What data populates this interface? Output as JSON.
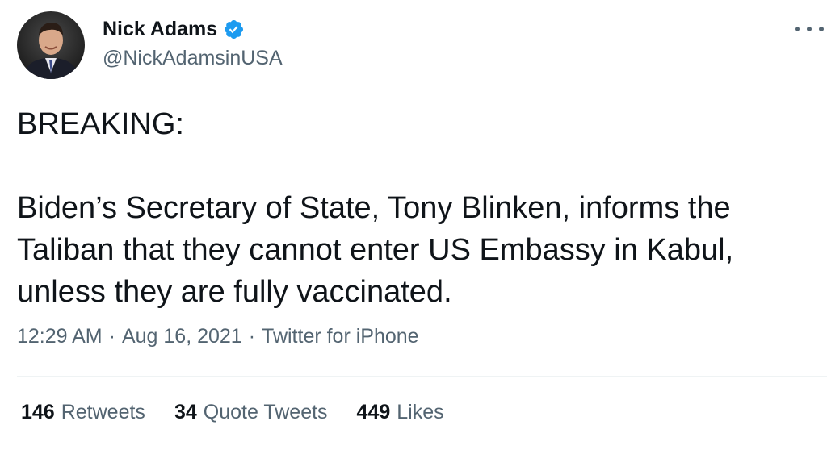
{
  "author": {
    "display_name": "Nick Adams",
    "handle": "@NickAdamsinUSA",
    "verified": true,
    "verified_icon": "verified-badge-icon"
  },
  "tweet": {
    "paragraphs": [
      "BREAKING:",
      "Biden’s Secretary of State, Tony Blinken, informs the Taliban that they cannot enter US Embassy in Kabul, unless they are fully vaccinated."
    ],
    "time": "12:29 AM",
    "date": "Aug 16, 2021",
    "separator": "·",
    "source": "Twitter for iPhone"
  },
  "stats": {
    "retweets": {
      "count": "146",
      "label": "Retweets"
    },
    "quote_tweets": {
      "count": "34",
      "label": "Quote Tweets"
    },
    "likes": {
      "count": "449",
      "label": "Likes"
    }
  },
  "colors": {
    "text_primary": "#0f1419",
    "text_secondary": "#536471",
    "verified_blue": "#1d9bf0",
    "divider": "#eff3f4"
  }
}
